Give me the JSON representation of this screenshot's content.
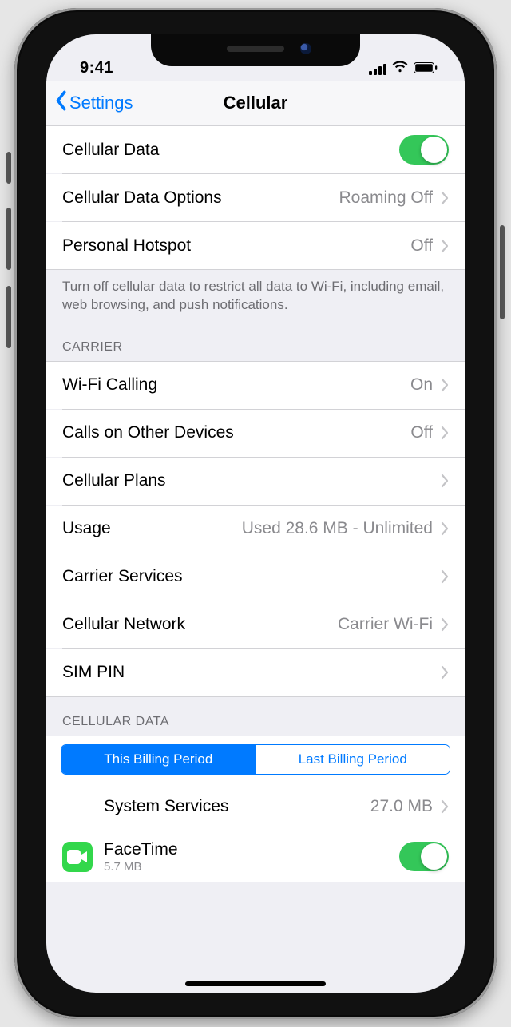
{
  "status": {
    "time": "9:41"
  },
  "nav": {
    "back_label": "Settings",
    "title": "Cellular"
  },
  "top_group": {
    "cellular_data": {
      "label": "Cellular Data",
      "on": true
    },
    "cellular_data_options": {
      "label": "Cellular Data Options",
      "detail": "Roaming Off"
    },
    "personal_hotspot": {
      "label": "Personal Hotspot",
      "detail": "Off"
    },
    "footnote": "Turn off cellular data to restrict all data to Wi-Fi, including email, web browsing, and push notifications."
  },
  "carrier": {
    "header": "CARRIER",
    "wifi_calling": {
      "label": "Wi-Fi Calling",
      "detail": "On"
    },
    "calls_other": {
      "label": "Calls on Other Devices",
      "detail": "Off"
    },
    "cellular_plans": {
      "label": "Cellular Plans",
      "detail": ""
    },
    "usage": {
      "label": "Usage",
      "detail": "Used 28.6 MB - Unlimited"
    },
    "carrier_services": {
      "label": "Carrier Services",
      "detail": ""
    },
    "cellular_network": {
      "label": "Cellular Network",
      "detail": "Carrier Wi-Fi"
    },
    "sim_pin": {
      "label": "SIM PIN",
      "detail": ""
    }
  },
  "cellular_data_section": {
    "header": "CELLULAR DATA",
    "segments": {
      "this_period": "This Billing Period",
      "last_period": "Last Billing Period",
      "selected": "this_period"
    },
    "system_services": {
      "label": "System Services",
      "detail": "27.0 MB"
    },
    "facetime": {
      "label": "FaceTime",
      "sub": "5.7 MB",
      "on": true
    }
  },
  "colors": {
    "tint": "#007aff",
    "toggle_on": "#34c759",
    "facetime_icon": "#32d74b"
  }
}
